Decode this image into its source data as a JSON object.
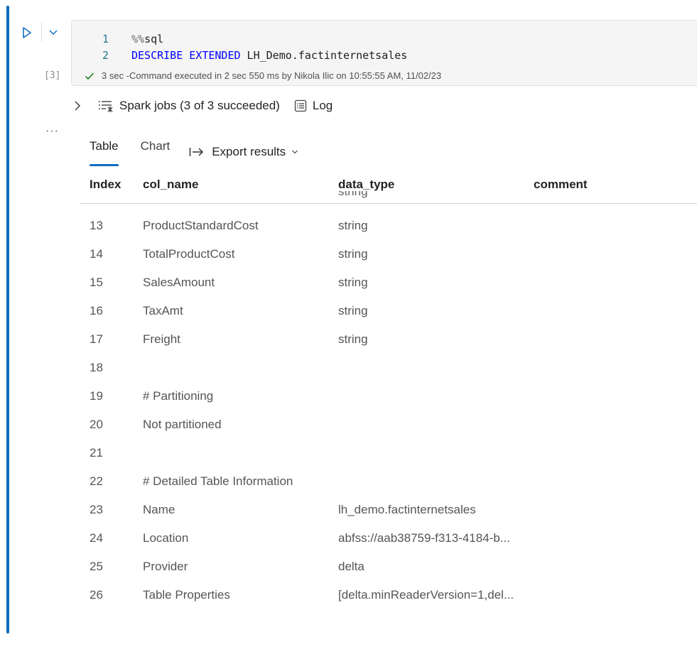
{
  "cell": {
    "execution_count": "[3]",
    "code_lines": [
      {
        "number": "1",
        "magic": "%%",
        "text": "sql"
      },
      {
        "number": "2",
        "keyword": "DESCRIBE EXTENDED",
        "text": " LH_Demo.factinternetsales"
      }
    ],
    "status": "3 sec -Command executed in 2 sec 550 ms by Nikola Ilic on 10:55:55 AM, 11/02/23"
  },
  "jobs": {
    "spark_jobs_label": "Spark jobs (3 of 3 succeeded)",
    "log_label": "Log"
  },
  "tabs": {
    "table_label": "Table",
    "chart_label": "Chart",
    "export_label": "Export results"
  },
  "table": {
    "columns": [
      "Index",
      "col_name",
      "data_type",
      "comment"
    ],
    "clipped_top_cell": "string",
    "rows": [
      {
        "index": "13",
        "col_name": "ProductStandardCost",
        "data_type": "string",
        "comment": ""
      },
      {
        "index": "14",
        "col_name": "TotalProductCost",
        "data_type": "string",
        "comment": ""
      },
      {
        "index": "15",
        "col_name": "SalesAmount",
        "data_type": "string",
        "comment": ""
      },
      {
        "index": "16",
        "col_name": "TaxAmt",
        "data_type": "string",
        "comment": ""
      },
      {
        "index": "17",
        "col_name": "Freight",
        "data_type": "string",
        "comment": ""
      },
      {
        "index": "18",
        "col_name": "",
        "data_type": "",
        "comment": ""
      },
      {
        "index": "19",
        "col_name": "# Partitioning",
        "data_type": "",
        "comment": ""
      },
      {
        "index": "20",
        "col_name": "Not partitioned",
        "data_type": "",
        "comment": ""
      },
      {
        "index": "21",
        "col_name": "",
        "data_type": "",
        "comment": ""
      },
      {
        "index": "22",
        "col_name": "# Detailed Table Information",
        "data_type": "",
        "comment": ""
      },
      {
        "index": "23",
        "col_name": "Name",
        "data_type": "lh_demo.factinternetsales",
        "comment": ""
      },
      {
        "index": "24",
        "col_name": "Location",
        "data_type": "abfss://aab38759-f313-4184-b...",
        "comment": ""
      },
      {
        "index": "25",
        "col_name": "Provider",
        "data_type": "delta",
        "comment": ""
      },
      {
        "index": "26",
        "col_name": "Table Properties",
        "data_type": "[delta.minReaderVersion=1,del...",
        "comment": ""
      }
    ]
  },
  "colors": {
    "accent": "#0f6cbd",
    "success": "#107c10",
    "keyword": "#0000ff",
    "line_number": "#237893"
  },
  "icons": [
    "play-icon",
    "chevron-down-icon",
    "check-icon",
    "chevron-right-icon",
    "spark-jobs-icon",
    "log-icon",
    "export-icon",
    "more-icon"
  ]
}
